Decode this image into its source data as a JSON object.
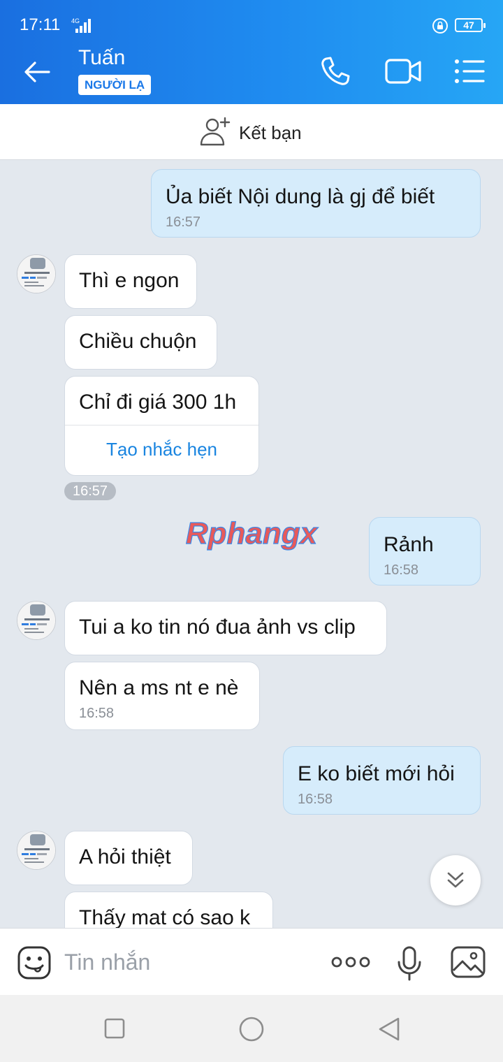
{
  "status_bar": {
    "time": "17:11",
    "network": "4G",
    "battery": "47"
  },
  "header": {
    "contact_name": "Tuấn",
    "badge": "NGƯỜI LẠ"
  },
  "friend_bar": {
    "label": "Kết bạn"
  },
  "messages": [
    {
      "side": "out",
      "text": "Ủa  biết  Nội dung là gj để biết",
      "time": "16:57"
    },
    {
      "side": "in",
      "text": "Thì e ngon"
    },
    {
      "side": "in",
      "text": "Chiều chuộn"
    },
    {
      "side": "in",
      "text": "Chỉ đi giá 300 1h",
      "action": "Tạo nhắc hẹn"
    },
    {
      "side": "out",
      "text": "Rảnh",
      "time": "16:58"
    },
    {
      "side": "in",
      "text": "Tui a ko tin nó đua ảnh vs clip"
    },
    {
      "side": "in",
      "text": "Nên a ms nt e nè",
      "time": "16:58"
    },
    {
      "side": "out",
      "text": "E ko biết mới hỏi",
      "time": "16:58"
    },
    {
      "side": "in",
      "text": "A hỏi thiệt"
    },
    {
      "side": "in",
      "text": "Thấy mat có sao k"
    }
  ],
  "time_pill": "16:57",
  "watermark": "Rphangx",
  "composer": {
    "placeholder": "Tin nhắn"
  },
  "colors": {
    "header_start": "#1a6fe0",
    "header_end": "#26a6f5",
    "outgoing_bubble": "#d6ecfb",
    "link": "#1a85e0"
  }
}
